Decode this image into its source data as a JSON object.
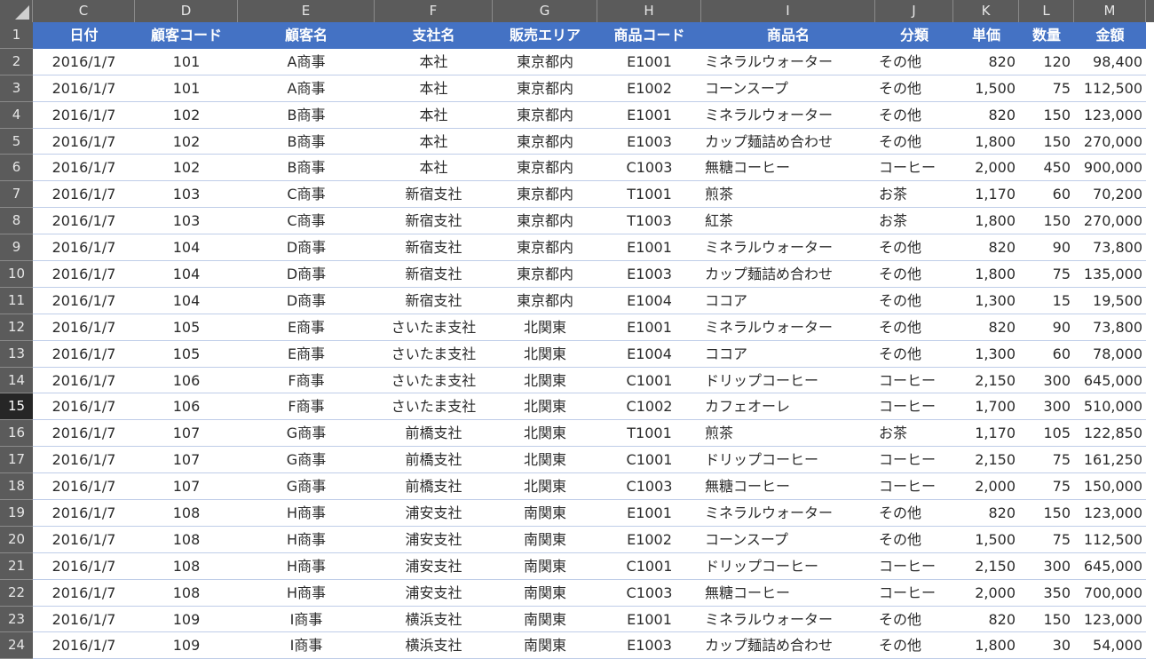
{
  "column_letters": [
    "C",
    "D",
    "E",
    "F",
    "G",
    "H",
    "I",
    "J",
    "K",
    "L",
    "M"
  ],
  "header": {
    "row_number": "1",
    "labels": [
      "日付",
      "顧客コード",
      "顧客名",
      "支社名",
      "販売エリア",
      "商品コード",
      "商品名",
      "分類",
      "単価",
      "数量",
      "金額"
    ]
  },
  "active_row": "15",
  "rows": [
    {
      "n": "2",
      "cells": [
        "2016/1/7",
        "101",
        "A商事",
        "本社",
        "東京都内",
        "E1001",
        "ミネラルウォーター",
        "その他",
        "820",
        "120",
        "98,400"
      ]
    },
    {
      "n": "3",
      "cells": [
        "2016/1/7",
        "101",
        "A商事",
        "本社",
        "東京都内",
        "E1002",
        "コーンスープ",
        "その他",
        "1,500",
        "75",
        "112,500"
      ]
    },
    {
      "n": "4",
      "cells": [
        "2016/1/7",
        "102",
        "B商事",
        "本社",
        "東京都内",
        "E1001",
        "ミネラルウォーター",
        "その他",
        "820",
        "150",
        "123,000"
      ]
    },
    {
      "n": "5",
      "cells": [
        "2016/1/7",
        "102",
        "B商事",
        "本社",
        "東京都内",
        "E1003",
        "カップ麺詰め合わせ",
        "その他",
        "1,800",
        "150",
        "270,000"
      ]
    },
    {
      "n": "6",
      "cells": [
        "2016/1/7",
        "102",
        "B商事",
        "本社",
        "東京都内",
        "C1003",
        "無糖コーヒー",
        "コーヒー",
        "2,000",
        "450",
        "900,000"
      ]
    },
    {
      "n": "7",
      "cells": [
        "2016/1/7",
        "103",
        "C商事",
        "新宿支社",
        "東京都内",
        "T1001",
        "煎茶",
        "お茶",
        "1,170",
        "60",
        "70,200"
      ]
    },
    {
      "n": "8",
      "cells": [
        "2016/1/7",
        "103",
        "C商事",
        "新宿支社",
        "東京都内",
        "T1003",
        "紅茶",
        "お茶",
        "1,800",
        "150",
        "270,000"
      ]
    },
    {
      "n": "9",
      "cells": [
        "2016/1/7",
        "104",
        "D商事",
        "新宿支社",
        "東京都内",
        "E1001",
        "ミネラルウォーター",
        "その他",
        "820",
        "90",
        "73,800"
      ]
    },
    {
      "n": "10",
      "cells": [
        "2016/1/7",
        "104",
        "D商事",
        "新宿支社",
        "東京都内",
        "E1003",
        "カップ麺詰め合わせ",
        "その他",
        "1,800",
        "75",
        "135,000"
      ]
    },
    {
      "n": "11",
      "cells": [
        "2016/1/7",
        "104",
        "D商事",
        "新宿支社",
        "東京都内",
        "E1004",
        "ココア",
        "その他",
        "1,300",
        "15",
        "19,500"
      ]
    },
    {
      "n": "12",
      "cells": [
        "2016/1/7",
        "105",
        "E商事",
        "さいたま支社",
        "北関東",
        "E1001",
        "ミネラルウォーター",
        "その他",
        "820",
        "90",
        "73,800"
      ]
    },
    {
      "n": "13",
      "cells": [
        "2016/1/7",
        "105",
        "E商事",
        "さいたま支社",
        "北関東",
        "E1004",
        "ココア",
        "その他",
        "1,300",
        "60",
        "78,000"
      ]
    },
    {
      "n": "14",
      "cells": [
        "2016/1/7",
        "106",
        "F商事",
        "さいたま支社",
        "北関東",
        "C1001",
        "ドリップコーヒー",
        "コーヒー",
        "2,150",
        "300",
        "645,000"
      ]
    },
    {
      "n": "15",
      "cells": [
        "2016/1/7",
        "106",
        "F商事",
        "さいたま支社",
        "北関東",
        "C1002",
        "カフェオーレ",
        "コーヒー",
        "1,700",
        "300",
        "510,000"
      ]
    },
    {
      "n": "16",
      "cells": [
        "2016/1/7",
        "107",
        "G商事",
        "前橋支社",
        "北関東",
        "T1001",
        "煎茶",
        "お茶",
        "1,170",
        "105",
        "122,850"
      ]
    },
    {
      "n": "17",
      "cells": [
        "2016/1/7",
        "107",
        "G商事",
        "前橋支社",
        "北関東",
        "C1001",
        "ドリップコーヒー",
        "コーヒー",
        "2,150",
        "75",
        "161,250"
      ]
    },
    {
      "n": "18",
      "cells": [
        "2016/1/7",
        "107",
        "G商事",
        "前橋支社",
        "北関東",
        "C1003",
        "無糖コーヒー",
        "コーヒー",
        "2,000",
        "75",
        "150,000"
      ]
    },
    {
      "n": "19",
      "cells": [
        "2016/1/7",
        "108",
        "H商事",
        "浦安支社",
        "南関東",
        "E1001",
        "ミネラルウォーター",
        "その他",
        "820",
        "150",
        "123,000"
      ]
    },
    {
      "n": "20",
      "cells": [
        "2016/1/7",
        "108",
        "H商事",
        "浦安支社",
        "南関東",
        "E1002",
        "コーンスープ",
        "その他",
        "1,500",
        "75",
        "112,500"
      ]
    },
    {
      "n": "21",
      "cells": [
        "2016/1/7",
        "108",
        "H商事",
        "浦安支社",
        "南関東",
        "C1001",
        "ドリップコーヒー",
        "コーヒー",
        "2,150",
        "300",
        "645,000"
      ]
    },
    {
      "n": "22",
      "cells": [
        "2016/1/7",
        "108",
        "H商事",
        "浦安支社",
        "南関東",
        "C1003",
        "無糖コーヒー",
        "コーヒー",
        "2,000",
        "350",
        "700,000"
      ]
    },
    {
      "n": "23",
      "cells": [
        "2016/1/7",
        "109",
        "I商事",
        "横浜支社",
        "南関東",
        "E1001",
        "ミネラルウォーター",
        "その他",
        "820",
        "150",
        "123,000"
      ]
    },
    {
      "n": "24",
      "cells": [
        "2016/1/7",
        "109",
        "I商事",
        "横浜支社",
        "南関東",
        "E1003",
        "カップ麺詰め合わせ",
        "その他",
        "1,800",
        "30",
        "54,000"
      ]
    }
  ],
  "colors": {
    "header_bg": "#4472c4",
    "header_text": "#ffffff",
    "grid_line": "#bfcde8",
    "gutter_bg": "#5b5b5b"
  }
}
